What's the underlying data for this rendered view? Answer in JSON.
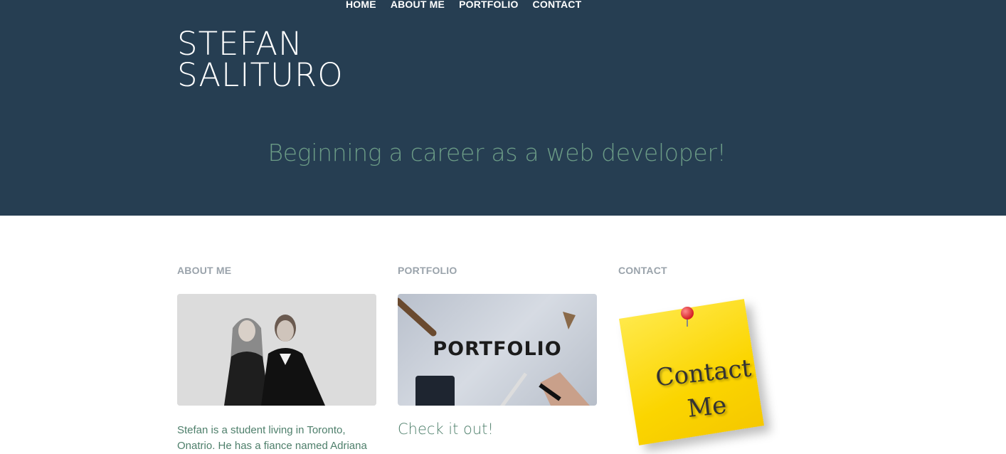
{
  "nav": {
    "items": [
      "HOME",
      "ABOUT ME",
      "PORTFOLIO",
      "CONTACT"
    ]
  },
  "brand": {
    "line1": "STEFAN",
    "line2": "SALITURO"
  },
  "hero": {
    "tagline": "Beginning a career as a web developer!"
  },
  "sections": {
    "about": {
      "heading": "ABOUT ME",
      "image_alt": "Black and white photo of Stefan and Adriana",
      "text": "Stefan is a student living in Toronto, Onatrio. He has a fiance named Adriana"
    },
    "portfolio": {
      "heading": "PORTFOLIO",
      "image_word": "PORTFOLIO",
      "link": "Check it out!"
    },
    "contact": {
      "heading": "CONTACT",
      "note_line1": "Contact",
      "note_line2": "Me"
    }
  },
  "colors": {
    "hero_bg": "#263e52",
    "accent_green": "#6b9b86",
    "text_green": "#4e7f6b",
    "heading_gray": "#9aa3ab"
  }
}
